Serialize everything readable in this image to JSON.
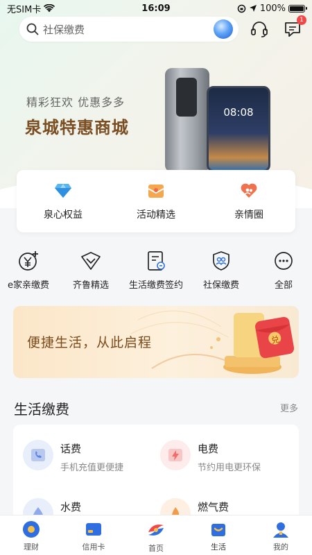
{
  "status_bar": {
    "carrier": "无SIM卡",
    "time": "16:09",
    "battery": "100%",
    "battery_level": 1.0
  },
  "header": {
    "search_placeholder": "社保缴费",
    "notification_count": "1"
  },
  "banner": {
    "subtitle": "精彩狂欢  优惠多多",
    "title": "泉城特惠商城",
    "phone_screen_time": "08:08"
  },
  "features": [
    {
      "label": "泉心权益",
      "icon": "diamond-icon"
    },
    {
      "label": "活动精选",
      "icon": "gift-box-icon"
    },
    {
      "label": "亲情圈",
      "icon": "family-heart-icon"
    }
  ],
  "quick_actions": [
    {
      "label": "e家亲缴费",
      "icon": "yuan-plus-icon"
    },
    {
      "label": "齐鲁精选",
      "icon": "chevron-badge-icon"
    },
    {
      "label": "生活缴费签约",
      "icon": "contract-icon"
    },
    {
      "label": "社保缴费",
      "icon": "shield-people-icon"
    },
    {
      "label": "全部",
      "icon": "more-dots-icon"
    }
  ],
  "promo": {
    "text": "便捷生活，从此启程",
    "gift_label": "兑"
  },
  "section": {
    "title": "生活缴费",
    "more": "更多"
  },
  "bills": [
    {
      "name": "话费",
      "desc": "手机充值更便捷",
      "icon": "phone-bill-icon",
      "color": "#5b86e5"
    },
    {
      "name": "电费",
      "desc": "节约用电更环保",
      "icon": "electric-bill-icon",
      "color": "#f06b6b"
    },
    {
      "name": "水费",
      "desc": "",
      "icon": "water-bill-icon",
      "color": "#5b86e5"
    },
    {
      "name": "燃气费",
      "desc": "",
      "icon": "gas-bill-icon",
      "color": "#f29b4b"
    }
  ],
  "tabs": [
    {
      "label": "理财",
      "icon": "wealth-icon"
    },
    {
      "label": "信用卡",
      "icon": "credit-card-icon"
    },
    {
      "label": "首页",
      "icon": "home-logo-icon"
    },
    {
      "label": "生活",
      "icon": "life-bag-icon"
    },
    {
      "label": "我的",
      "icon": "profile-icon"
    }
  ],
  "colors": {
    "brand_brown": "#7a4e22",
    "accent_blue": "#2f6ee0",
    "badge_red": "#f04848"
  }
}
